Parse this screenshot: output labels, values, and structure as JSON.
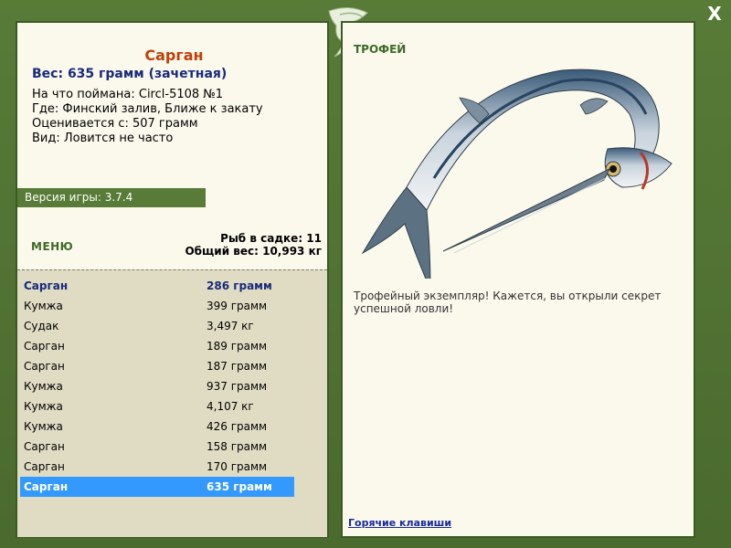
{
  "fish": {
    "name": "Сарган",
    "weight_line": "Вес: 635 грамм (зачетная)",
    "caught_on": "На что поймана: Circl-5108 №1",
    "where": "Где: Финский залив, Ближе к закату",
    "rated_from": "Оценивается с: 507 грамм",
    "kind": "Вид: Ловится не часто"
  },
  "version": "Версия игры: 3.7.4",
  "menu_label": "МЕНЮ",
  "stats": {
    "count_line": "Рыб в садке: 11",
    "total_line": "Общий вес: 10,993 кг"
  },
  "catch_list": [
    {
      "name": "Сарган",
      "weight": "286 грамм"
    },
    {
      "name": "Кумжа",
      "weight": "399 грамм"
    },
    {
      "name": "Судак",
      "weight": "3,497 кг"
    },
    {
      "name": "Сарган",
      "weight": "189 грамм"
    },
    {
      "name": "Сарган",
      "weight": "187 грамм"
    },
    {
      "name": "Кумжа",
      "weight": "937 грамм"
    },
    {
      "name": "Кумжа",
      "weight": "4,107 кг"
    },
    {
      "name": "Кумжа",
      "weight": "426 грамм"
    },
    {
      "name": "Сарган",
      "weight": "158 грамм"
    },
    {
      "name": "Сарган",
      "weight": "170 грамм"
    },
    {
      "name": "Сарган",
      "weight": "635 грамм"
    }
  ],
  "trophy": {
    "label": "ТРОФЕЙ",
    "text": "Трофейный экземпляр! Кажется, вы открыли секрет успешной ловли!"
  },
  "hotkeys": "Горячие клавиши",
  "close": "X",
  "icons": {
    "close": "close-icon",
    "emblem": "fish-emblem-icon"
  },
  "colors": {
    "frame": "#587b38",
    "panel": "#fbf9ec",
    "list_bg": "#e0dcc3",
    "selected": "#3399ff",
    "title": "#c0400a"
  }
}
